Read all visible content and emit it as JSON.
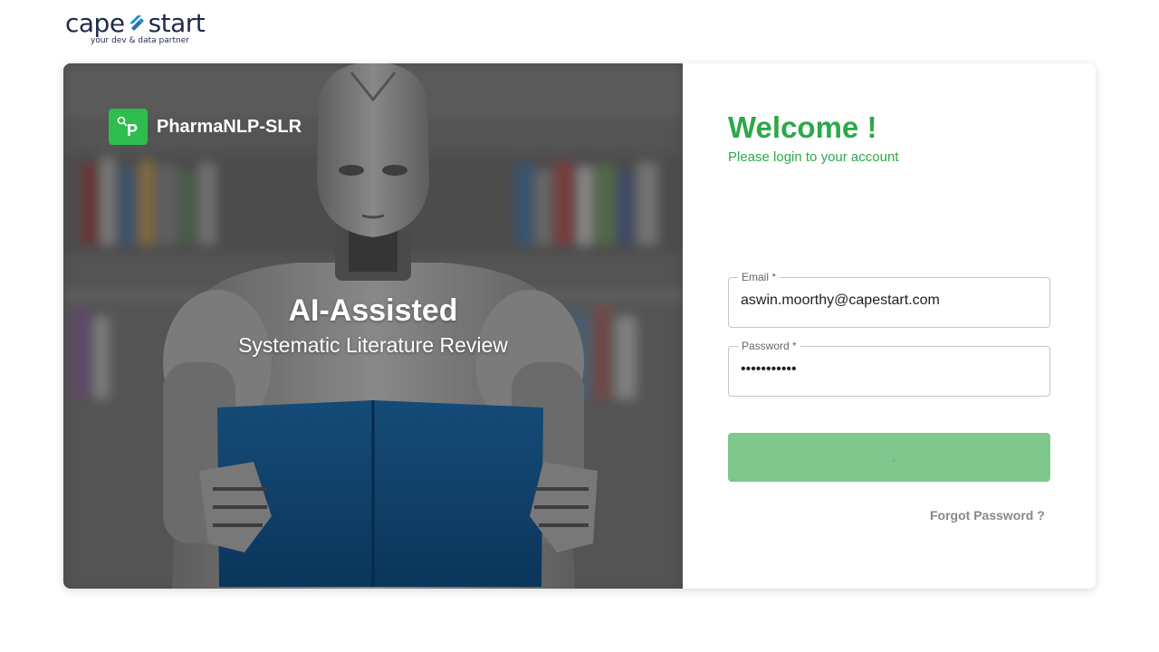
{
  "logo": {
    "word_left": "cape",
    "word_right": "start",
    "tagline": "your dev & data partner"
  },
  "hero": {
    "brand_initial": "P",
    "brand_name": "PharmaNLP-SLR",
    "title": "AI-Assisted",
    "subtitle": "Systematic Literature Review"
  },
  "login": {
    "welcome": "Welcome !",
    "subtitle": "Please login to your account",
    "email_label": "Email *",
    "email_value": "aswin.moorthy@capestart.com",
    "password_label": "Password *",
    "password_value": "•••••••••••",
    "forgot": "Forgot Password ?"
  },
  "colors": {
    "brand_green": "#2ea84a",
    "button_green": "#7fc88d",
    "logo_navy": "#1f2a4a",
    "logo_blue": "#1e8fd6"
  }
}
